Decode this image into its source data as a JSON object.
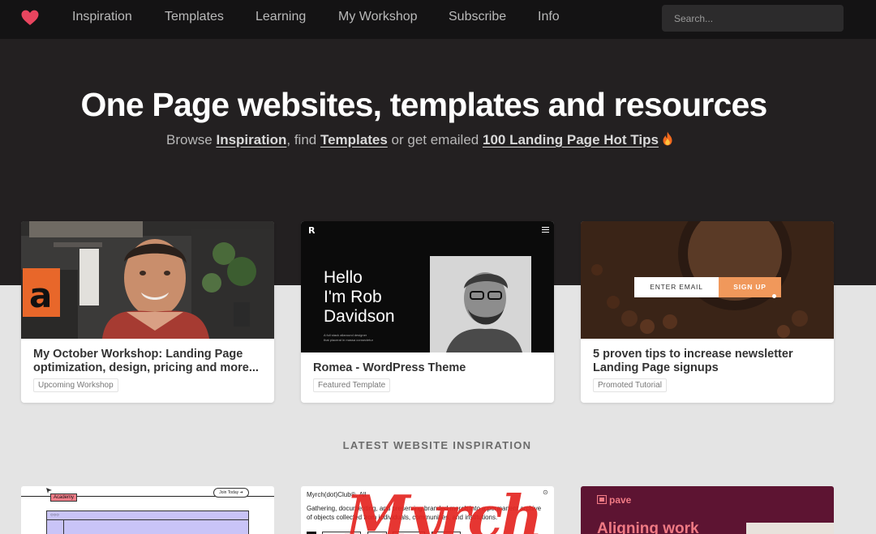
{
  "nav": {
    "items": [
      {
        "label": "Inspiration"
      },
      {
        "label": "Templates"
      },
      {
        "label": "Learning"
      },
      {
        "label": "My Workshop"
      },
      {
        "label": "Subscribe"
      },
      {
        "label": "Info"
      }
    ],
    "search_placeholder": "Search...",
    "logo_icon": "heart-icon",
    "accent": "#e8455f"
  },
  "hero": {
    "title": "One Page websites, templates and resources",
    "sub_browse": "Browse ",
    "sub_link1": "Inspiration",
    "sub_find": ", find ",
    "sub_link2": "Templates",
    "sub_or": " or get emailed ",
    "sub_link3": "100 Landing Page Hot Tips",
    "fire_icon": "fire-icon"
  },
  "featured": [
    {
      "title": "My October Workshop: Landing Page optimization, design, pricing and more...",
      "tag": "Upcoming Workshop"
    },
    {
      "title": "Romea - WordPress Theme",
      "tag": "Featured Template",
      "thumb_heading_1": "Hello",
      "thumb_heading_2": "I'm Rob",
      "thumb_heading_3": "Davidson",
      "thumb_logo": "R",
      "thumb_caption_1": "A full stack allaround designer",
      "thumb_caption_2": "that placerat in massa consectetur"
    },
    {
      "title": "5 proven tips to increase newsletter Landing Page signups",
      "tag": "Promoted Tutorial",
      "thumb_email_placeholder": "ENTER EMAIL",
      "thumb_signup": "SIGN UP"
    }
  ],
  "latest": {
    "label": "LATEST WEBSITE INSPIRATION",
    "items": [
      {
        "badge": "Academy",
        "button": "Join Today"
      },
      {
        "heading": "Myrch(dot)Club®, All",
        "text": "Gathering, documenting, and preserving branded merch into a permanent archive of objects collected from individuals, communities, and institutions.",
        "overlay": "Myrch"
      },
      {
        "logo": "pave",
        "heading": "Aligning work"
      }
    ]
  }
}
